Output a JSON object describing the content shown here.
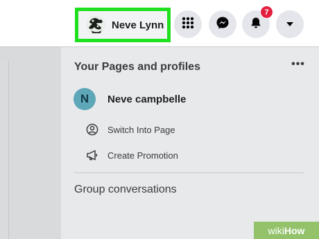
{
  "header": {
    "profile_name": "Neve Lynn",
    "menu_icon": "grid-menu-icon",
    "messenger_icon": "messenger-icon",
    "notifications_icon": "bell-icon",
    "notifications_count": "7",
    "account_icon": "caret-down-icon",
    "highlight_color": "#1fe01f"
  },
  "panel": {
    "title": "Your Pages and profiles",
    "more_label": "•••",
    "page": {
      "avatar_letter": "N",
      "name": "Neve campbelle"
    },
    "actions": [
      {
        "label": "Switch Into Page",
        "icon": "switch-profile-icon"
      },
      {
        "label": "Create Promotion",
        "icon": "megaphone-icon"
      }
    ],
    "section_title": "Group conversations"
  },
  "watermark": {
    "wiki": "wiki",
    "how": "How"
  }
}
